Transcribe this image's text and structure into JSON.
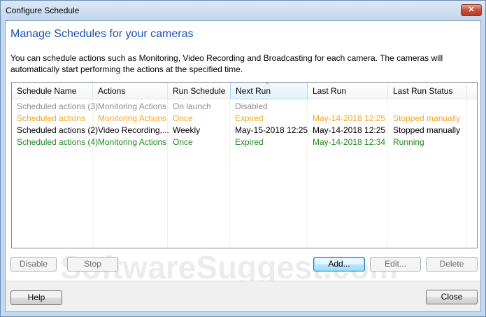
{
  "window": {
    "title": "Configure Schedule",
    "close_glyph": "✕"
  },
  "heading": "Manage Schedules for your cameras",
  "description": "You can schedule actions such as Monitoring, Video Recording and Broadcasting for each camera. The cameras will automatically start performing the actions at the specified time.",
  "columns": [
    "Schedule Name",
    "Actions",
    "Run Schedule",
    "Next Run",
    "Last Run",
    "Last Run Status"
  ],
  "sort_glyph": "^",
  "rows": [
    {
      "name": "Scheduled actions (3)",
      "actions": "Monitoring Actions",
      "run_schedule": "On launch",
      "next_run": "Disabled",
      "last_run": "",
      "status": "",
      "color": "#8c8c8c"
    },
    {
      "name": "Scheduled actions",
      "actions": "Monitoring Actions",
      "run_schedule": "Once",
      "next_run": "Expired",
      "last_run": "May-14-2018 12:25",
      "status": "Stopped manually",
      "color": "#f5a623"
    },
    {
      "name": "Scheduled actions (2)",
      "actions": "Video Recording,...",
      "run_schedule": "Weekly",
      "next_run": "May-15-2018 12:25",
      "last_run": "May-14-2018 12:25",
      "status": "Stopped manually",
      "color": "#000000"
    },
    {
      "name": "Scheduled actions (4)",
      "actions": "Monitoring Actions",
      "run_schedule": "Once",
      "next_run": "Expired",
      "last_run": "May-14-2018 12:34",
      "status": "Running",
      "color": "#1e8a1e"
    }
  ],
  "buttons": {
    "disable": "Disable",
    "stop": "Stop",
    "add": "Add...",
    "edit": "Edit...",
    "delete": "Delete",
    "help": "Help",
    "close": "Close"
  },
  "watermark": "SoftwareSuggest.com"
}
